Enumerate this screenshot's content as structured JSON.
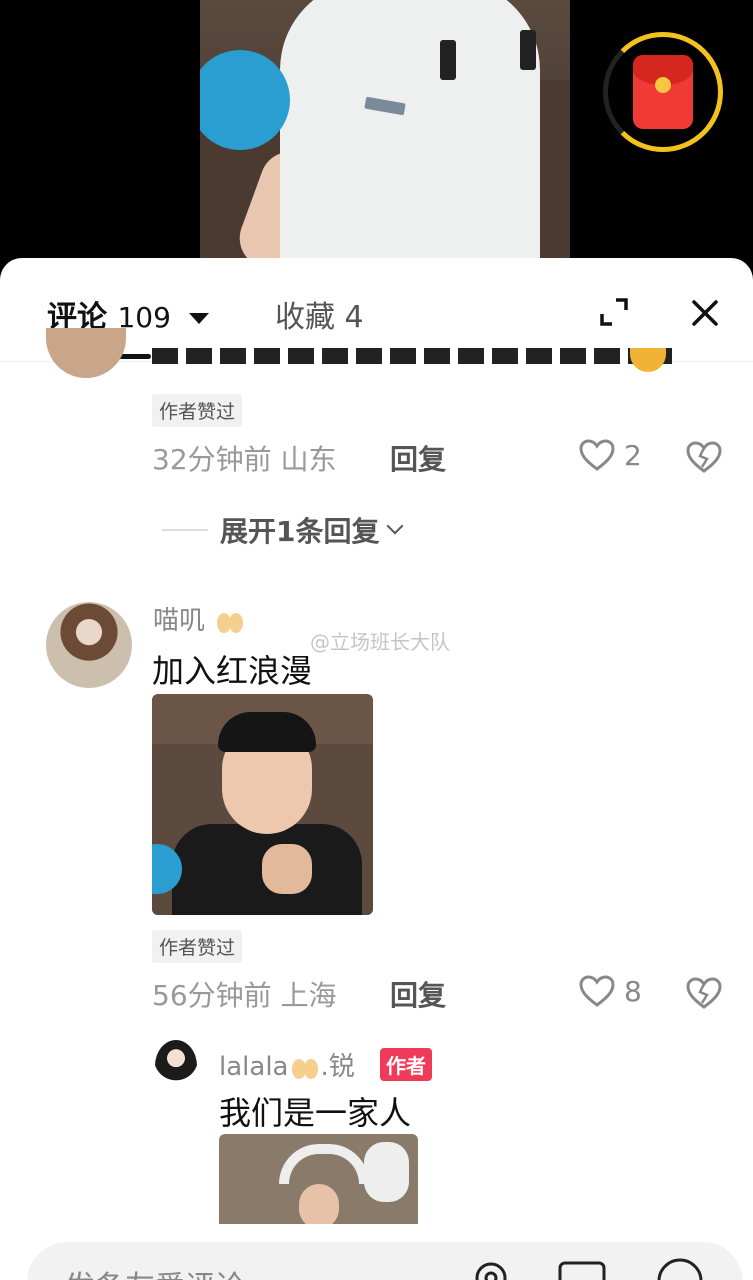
{
  "tabs": {
    "comments_label": "评论",
    "comments_count": "109",
    "favorites_label": "收藏",
    "favorites_count": "4"
  },
  "previous_comment": {
    "liked_badge": "作者赞过",
    "time_location": "32分钟前 山东",
    "reply_label": "回复",
    "like_count": "2",
    "expand_replies": "展开1条回复"
  },
  "watermark": "@立场班长大队",
  "comment1": {
    "username": "喵叽",
    "text": "加入红浪漫",
    "liked_badge": "作者赞过",
    "time_location": "56分钟前 上海",
    "reply_label": "回复",
    "like_count": "8"
  },
  "reply1": {
    "username_prefix": "lalala",
    "username_suffix": ".锐",
    "author_badge": "作者",
    "text": "我们是一家人"
  },
  "input": {
    "placeholder": "发条友爱评论"
  },
  "icons": {
    "expand": "expand-icon",
    "close": "close-icon",
    "heart": "heart-icon",
    "dislike": "broken-heart-icon",
    "at": "at-icon",
    "image": "image-icon",
    "emoji": "emoji-icon",
    "red_packet": "red-packet-icon"
  },
  "colors": {
    "author_badge": "#f03a5a",
    "red_packet": "#f03a35",
    "ring": "#f4c21d"
  }
}
